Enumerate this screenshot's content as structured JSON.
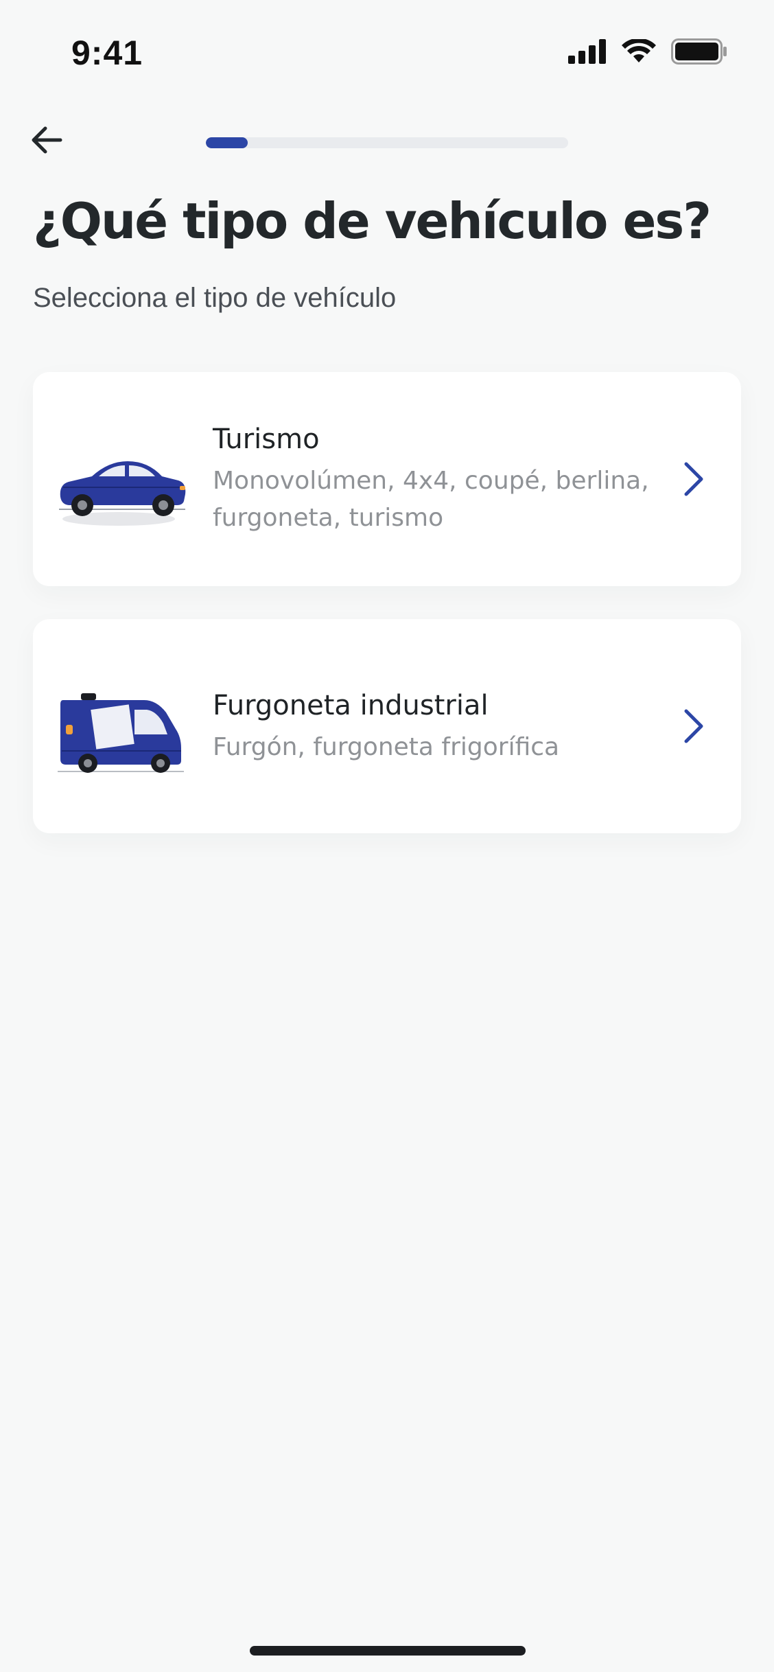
{
  "status_bar": {
    "time": "9:41",
    "icons": [
      "cellular-signal-icon",
      "wifi-icon",
      "battery-icon"
    ]
  },
  "nav": {
    "back_icon": "arrow-left-icon",
    "progress_fraction": 0.115,
    "colors": {
      "progress_fill": "#2c46a6",
      "progress_track": "#e9ebee"
    }
  },
  "header": {
    "title": "¿Qué tipo de vehículo es?",
    "subtitle": "Selecciona el tipo de vehículo"
  },
  "options": [
    {
      "title": "Turismo",
      "description": "Monovolúmen, 4x4, coupé, berlina, furgoneta, turismo",
      "icon": "car-illustration"
    },
    {
      "title": "Furgoneta industrial",
      "description": "Furgón, furgoneta frigorífica",
      "icon": "van-illustration"
    }
  ],
  "colors": {
    "accent": "#2c46a6",
    "vehicle_blue": "#2a3a9c",
    "background": "#f7f8f8"
  }
}
